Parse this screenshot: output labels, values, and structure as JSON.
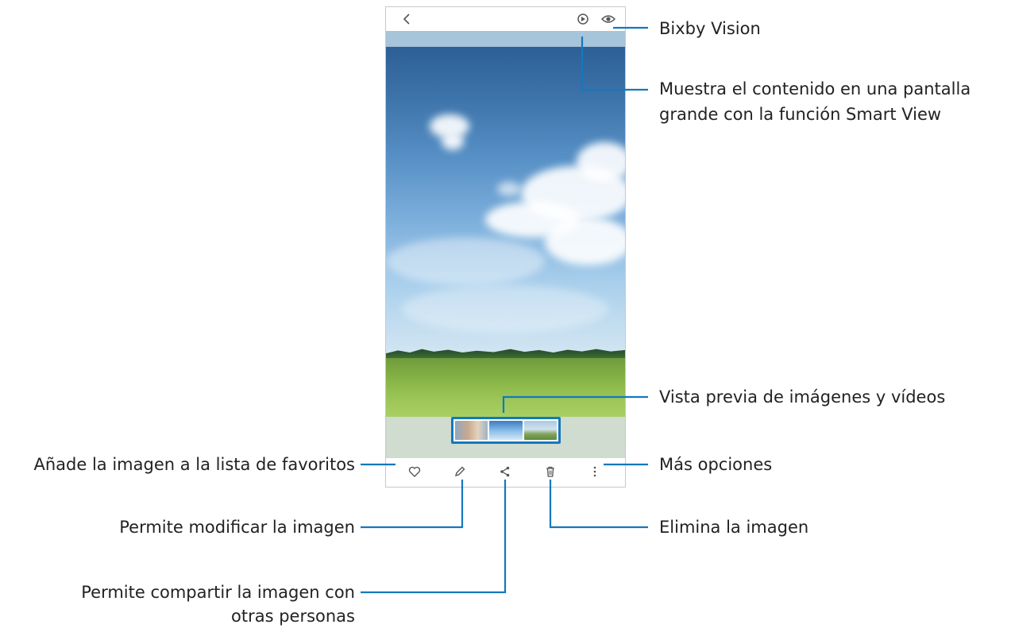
{
  "viewer": {
    "back_icon": "chevron-left-icon",
    "top_icons": [
      "smart-view-icon",
      "eye-icon"
    ],
    "bottom_icons": [
      "heart-icon",
      "pencil-icon",
      "share-icon",
      "trash-icon",
      "more-vertical-icon"
    ],
    "thumbnails_count": 3
  },
  "callouts": {
    "bixby_vision": "Bixby Vision",
    "smart_view_line1": "Muestra el contenido en una pantalla",
    "smart_view_line2": "grande con la función Smart View",
    "preview": "Vista previa de imágenes y vídeos",
    "favorites": "Añade la imagen a la lista de favoritos",
    "more_options": "Más opciones",
    "edit": "Permite modificar la imagen",
    "delete": "Elimina la imagen",
    "share_line1": "Permite compartir la imagen con",
    "share_line2": "otras personas"
  },
  "colors": {
    "callout_line": "#1478bd",
    "thumb_border": "#1478bd",
    "frame_border": "#c9c9c9"
  }
}
